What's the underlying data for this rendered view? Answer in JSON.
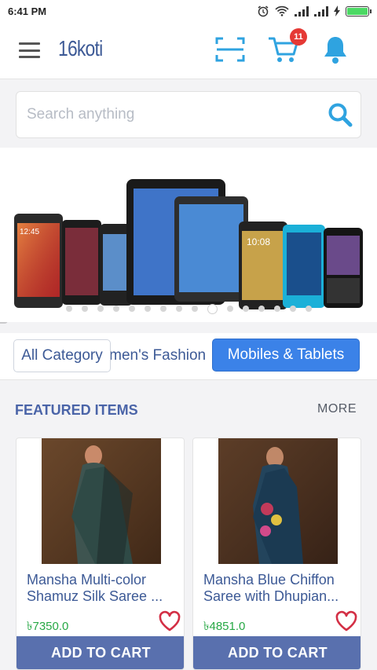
{
  "status_bar": {
    "time": "6:41 PM"
  },
  "app_bar": {
    "brand": "16koti",
    "cart_count": "11"
  },
  "search": {
    "placeholder": "Search anything"
  },
  "banner": {
    "phone_screen_time_1": "12:45",
    "phone_screen_time_2": "10:08"
  },
  "categories": [
    {
      "label": "All Category"
    },
    {
      "label": "Women's Fashion"
    },
    {
      "label": "Mobiles & Tablets"
    }
  ],
  "featured": {
    "title": "FEATURED ITEMS",
    "more_label": "MORE"
  },
  "products": [
    {
      "name": "Mansha Multi-color Shamuz Silk Saree ...",
      "price": "৳7350.0",
      "button": "ADD TO CART"
    },
    {
      "name": "Mansha Blue Chiffon Saree with Dhupian...",
      "price": "৳4851.0",
      "button": "ADD TO CART"
    }
  ],
  "colors": {
    "brand_blue": "#3d5a96",
    "chip_active": "#3b82e8",
    "cart_button": "#5970ae",
    "price_green": "#27a845",
    "badge_red": "#e53935"
  }
}
